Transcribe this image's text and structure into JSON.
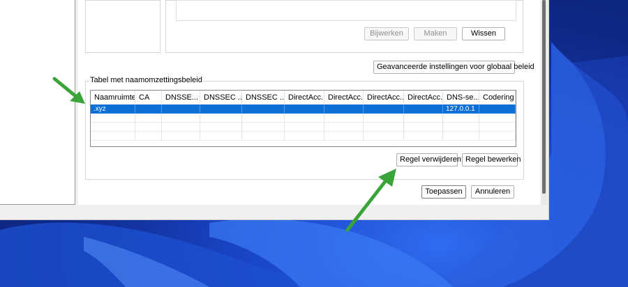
{
  "buttons_top": {
    "update": "Bijwerken",
    "create": "Maken",
    "clear": "Wissen"
  },
  "advanced_button": "Geavanceerde instellingen voor globaal beleid",
  "policy_table": {
    "title": "Tabel met naamomzettingsbeleid",
    "columns": [
      "Naamruimte",
      "CA",
      "DNSSE...",
      "DNSSEC ...",
      "DNSSEC ...",
      "DirectAcc...",
      "DirectAcc...",
      "DirectAcc...",
      "DirectAcc...",
      "DNS-se...",
      "Codering"
    ],
    "rows": [
      [
        ".xyz",
        "",
        "",
        "",
        "",
        "",
        "",
        "",
        "",
        "127.0.0.1",
        ""
      ]
    ],
    "selected_row": 0
  },
  "buttons_rule": {
    "delete": "Regel verwijderen",
    "edit": "Regel bewerken"
  },
  "buttons_bottom": {
    "apply": "Toepassen",
    "cancel": "Annuleren"
  },
  "colors": {
    "selection": "#0c6fd6",
    "arrow": "#3aa33a"
  },
  "icons": [
    "arrow-annotation-icon"
  ]
}
